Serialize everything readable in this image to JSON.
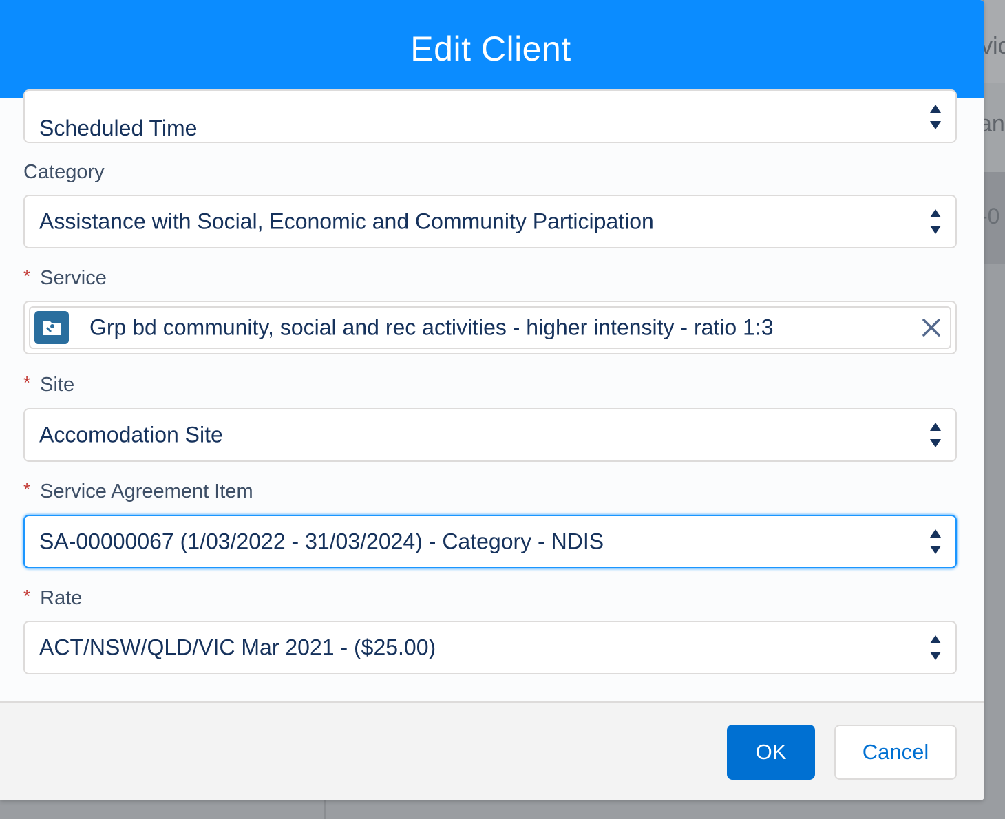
{
  "background": {
    "peek_text_top": "vic",
    "peek_text_mid": "an",
    "peek_text_row": "-0"
  },
  "modal": {
    "title": "Edit Client"
  },
  "fields": {
    "scheduled_time": {
      "value": "Scheduled Time"
    },
    "category": {
      "label": "Category",
      "value": "Assistance with Social, Economic and Community Participation"
    },
    "service": {
      "required_mark": "*",
      "label": "Service",
      "value": "Grp bd community, social and rec activities - higher intensity - ratio 1:3",
      "icon": "service-record-icon"
    },
    "site": {
      "required_mark": "*",
      "label": "Site",
      "value": "Accomodation Site"
    },
    "service_agreement_item": {
      "required_mark": "*",
      "label": "Service Agreement Item",
      "value": "SA-00000067 (1/03/2022 - 31/03/2024) - Category - NDIS"
    },
    "rate": {
      "required_mark": "*",
      "label": "Rate",
      "value": "ACT/NSW/QLD/VIC Mar 2021 - ($25.00)"
    }
  },
  "footer": {
    "ok_label": "OK",
    "cancel_label": "Cancel"
  },
  "colors": {
    "header_blue": "#0b8cff",
    "button_blue": "#0070d2",
    "required_red": "#c23934",
    "text_dark": "#16325c",
    "focus_ring": "#1b96ff"
  }
}
